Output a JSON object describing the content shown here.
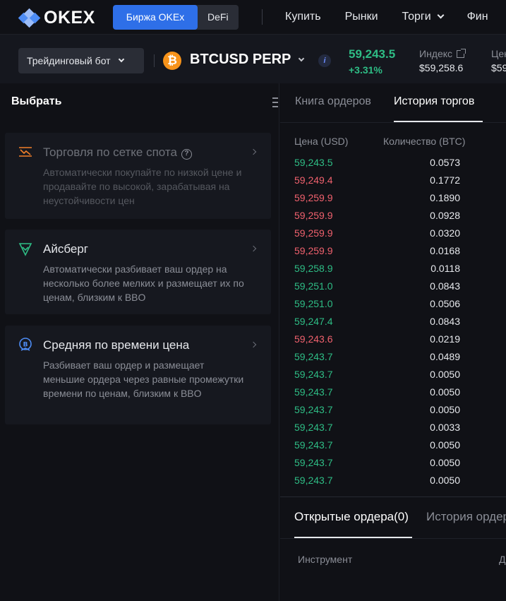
{
  "brand": {
    "name": "OKEX"
  },
  "topnav": {
    "segment": [
      {
        "label": "Биржа OKEx",
        "active": true
      },
      {
        "label": "DeFi",
        "active": false
      }
    ],
    "links": [
      "Купить",
      "Рынки",
      "Торги",
      "Фин"
    ]
  },
  "ticker": {
    "bot_button": "Трейдинговый бот",
    "coin_icon": "₿",
    "pair": "BTCUSD PERP",
    "info_icon": "i",
    "last_price": "59,243.5",
    "change": "+3.31%",
    "index_label": "Индекс",
    "index_value": "$59,258.6",
    "next_label": "Цен",
    "next_value": "$59"
  },
  "left_panel": {
    "title": "Выбрать",
    "cards": [
      {
        "title": "Торговля по сетке спота",
        "help": "?",
        "description": "Автоматически покупайте по низкой цене и продавайте по высокой, зарабатывая на неустойчивости цен",
        "icon": "grid-trading-icon",
        "dim": true
      },
      {
        "title": "Айсберг",
        "description": "Автоматически разбивает ваш ордер на несколько более мелких и размещает их по ценам, близким к BBO",
        "icon": "iceberg-icon",
        "dim": false
      },
      {
        "title": "Средняя по времени цена",
        "description": "Разбивает ваш ордер и размещает меньшие ордера через равные промежутки времени по ценам, близким к BBO",
        "icon": "twap-icon",
        "dim": false
      }
    ]
  },
  "trades_panel": {
    "tabs": [
      "Книга ордеров",
      "История торгов"
    ],
    "active_tab": 1,
    "columns": {
      "price": "Цена (USD)",
      "qty": "Количество (BTC)"
    },
    "rows": [
      {
        "price": "59,243.5",
        "qty": "0.0573",
        "side": "up"
      },
      {
        "price": "59,249.4",
        "qty": "0.1772",
        "side": "down"
      },
      {
        "price": "59,259.9",
        "qty": "0.1890",
        "side": "down"
      },
      {
        "price": "59,259.9",
        "qty": "0.0928",
        "side": "down"
      },
      {
        "price": "59,259.9",
        "qty": "0.0320",
        "side": "down"
      },
      {
        "price": "59,259.9",
        "qty": "0.0168",
        "side": "down"
      },
      {
        "price": "59,258.9",
        "qty": "0.0118",
        "side": "up"
      },
      {
        "price": "59,251.0",
        "qty": "0.0843",
        "side": "up"
      },
      {
        "price": "59,251.0",
        "qty": "0.0506",
        "side": "up"
      },
      {
        "price": "59,247.4",
        "qty": "0.0843",
        "side": "up"
      },
      {
        "price": "59,243.6",
        "qty": "0.0219",
        "side": "down"
      },
      {
        "price": "59,243.7",
        "qty": "0.0489",
        "side": "up"
      },
      {
        "price": "59,243.7",
        "qty": "0.0050",
        "side": "up"
      },
      {
        "price": "59,243.7",
        "qty": "0.0050",
        "side": "up"
      },
      {
        "price": "59,243.7",
        "qty": "0.0050",
        "side": "up"
      },
      {
        "price": "59,243.7",
        "qty": "0.0033",
        "side": "up"
      },
      {
        "price": "59,243.7",
        "qty": "0.0050",
        "side": "up"
      },
      {
        "price": "59,243.7",
        "qty": "0.0050",
        "side": "up"
      },
      {
        "price": "59,243.7",
        "qty": "0.0050",
        "side": "up"
      }
    ],
    "colors": {
      "up": "#2ebd85",
      "down": "#f0616d"
    }
  },
  "orders_panel": {
    "tabs": [
      "Открытые ордера(0)",
      "История ордера"
    ],
    "columns": [
      "Инструмент",
      "Д"
    ]
  }
}
